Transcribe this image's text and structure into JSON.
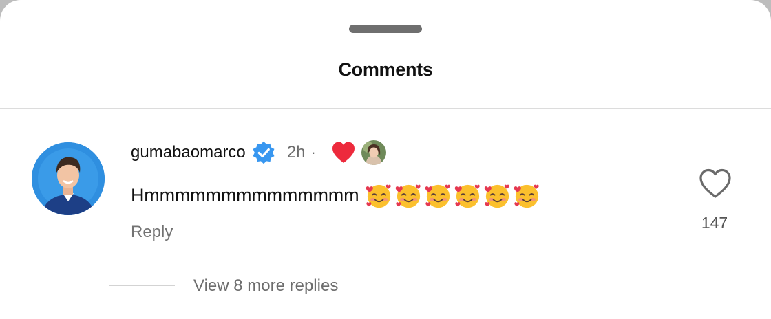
{
  "header": {
    "title": "Comments"
  },
  "comment": {
    "username": "gumabaomarco",
    "verified": true,
    "time": "2h",
    "separator": "·",
    "author_liked": true,
    "text": "Hmmmmmmmmmmmmmm",
    "emojis": [
      "smiling-face-with-hearts",
      "smiling-face-with-hearts",
      "smiling-face-with-hearts",
      "smiling-face-with-hearts",
      "smiling-face-with-hearts",
      "smiling-face-with-hearts"
    ],
    "reply_label": "Reply",
    "like_count": "147",
    "view_replies_label": "View 8 more replies"
  },
  "colors": {
    "verified_badge": "#3897f0",
    "author_heart": "#ed2a3c",
    "secondary_text": "#737373",
    "divider": "#dcdcdc"
  }
}
